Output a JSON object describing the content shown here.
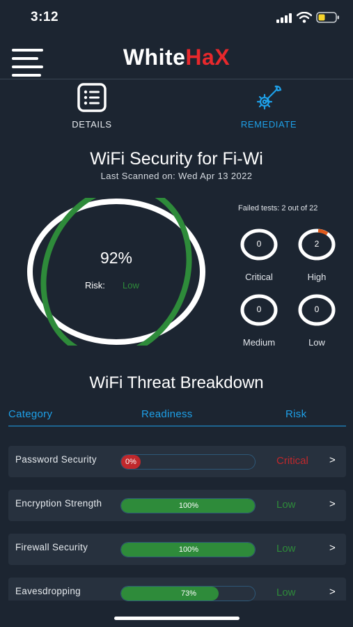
{
  "status_bar": {
    "time": "3:12"
  },
  "header": {
    "logo_part1": "White",
    "logo_part2": "HaX"
  },
  "tabs": [
    {
      "label": "DETAILS",
      "icon": "list-document-icon",
      "active": false
    },
    {
      "label": "REMEDIATE",
      "icon": "gear-wrench-icon",
      "active": true
    }
  ],
  "scan": {
    "title": "WiFi Security for Fi-Wi",
    "subtitle": "Last Scanned on: Wed Apr 13 2022",
    "score": "92%",
    "score_value": 0.92,
    "risk_label": "Risk:",
    "risk_value": "Low",
    "failed_tests": "Failed tests: 2 out of 22"
  },
  "severity": [
    {
      "label": "Critical",
      "count": "0"
    },
    {
      "label": "High",
      "count": "2"
    },
    {
      "label": "Medium",
      "count": "0"
    },
    {
      "label": "Low",
      "count": "0"
    }
  ],
  "breakdown": {
    "title": "WiFi Threat Breakdown",
    "columns": {
      "category": "Category",
      "readiness": "Readiness",
      "risk": "Risk"
    },
    "rows": [
      {
        "name": "Password Security",
        "readiness": "0%",
        "readiness_value": 0,
        "risk": "Critical",
        "risk_color": "#c0282c"
      },
      {
        "name": "Encryption Strength",
        "readiness": "100%",
        "readiness_value": 1.0,
        "risk": "Low",
        "risk_color": "#2e8b3a"
      },
      {
        "name": "Firewall Security",
        "readiness": "100%",
        "readiness_value": 1.0,
        "risk": "Low",
        "risk_color": "#2e8b3a"
      },
      {
        "name": "Eavesdropping",
        "readiness": "73%",
        "readiness_value": 0.73,
        "risk": "Low",
        "risk_color": "#2e8b3a"
      }
    ],
    "chevron": ">"
  },
  "colors": {
    "background": "#1c2531",
    "accent_blue": "#1ea0e8",
    "green": "#2e8b3a",
    "critical_red": "#c0282c",
    "brand_red": "#e8282c",
    "high_orange": "#e05a1c"
  }
}
